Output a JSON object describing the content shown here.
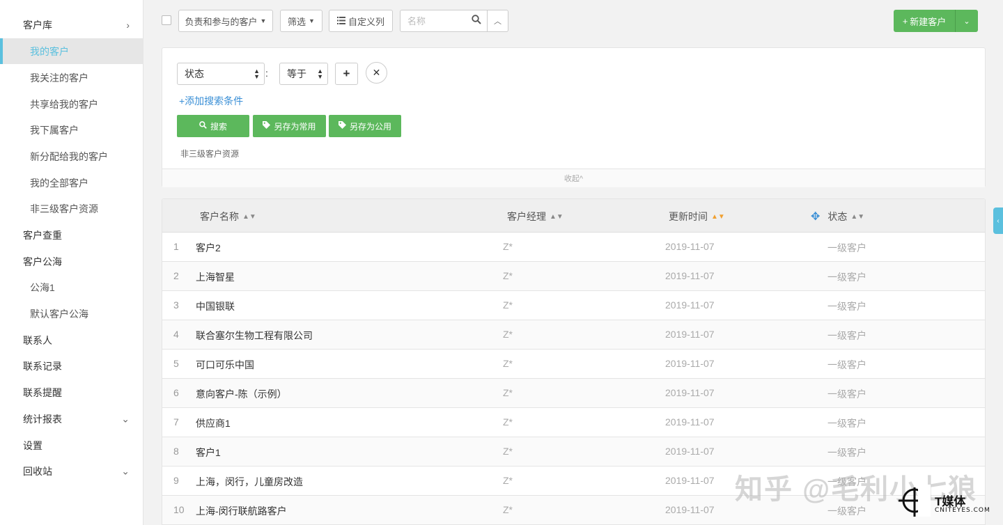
{
  "sidebar": {
    "items": [
      {
        "label": "客户库",
        "level": 1,
        "caret": "›"
      },
      {
        "label": "我的客户",
        "level": 2,
        "active": true
      },
      {
        "label": "我关注的客户",
        "level": 2
      },
      {
        "label": "共享给我的客户",
        "level": 2
      },
      {
        "label": "我下属客户",
        "level": 2
      },
      {
        "label": "新分配给我的客户",
        "level": 2
      },
      {
        "label": "我的全部客户",
        "level": 2
      },
      {
        "label": "非三级客户资源",
        "level": 2
      },
      {
        "label": "客户查重",
        "level": 1
      },
      {
        "label": "客户公海",
        "level": 1
      },
      {
        "label": "公海1",
        "level": 2
      },
      {
        "label": "默认客户公海",
        "level": 2
      },
      {
        "label": "联系人",
        "level": 1
      },
      {
        "label": "联系记录",
        "level": 1
      },
      {
        "label": "联系提醒",
        "level": 1
      },
      {
        "label": "统计报表",
        "level": 1,
        "caret": "⌄"
      },
      {
        "label": "设置",
        "level": 1
      },
      {
        "label": "回收站",
        "level": 1,
        "caret": "⌄"
      }
    ]
  },
  "toolbar": {
    "scope_label": "负责和参与的客户",
    "filter_label": "筛选",
    "custom_columns_label": "自定义列",
    "search_placeholder": "名称",
    "new_customer_label": "新建客户"
  },
  "filter": {
    "field_value": "状态",
    "colon": ":",
    "operator_value": "等于",
    "add_condition_label": "添加搜索条件",
    "search_button": "搜索",
    "save_common_button": "另存为常用",
    "save_public_button": "另存为公用",
    "note": "非三级客户资源",
    "collapse_label": "收起^"
  },
  "table": {
    "headers": [
      "客户名称",
      "客户经理",
      "更新时间",
      "状态"
    ],
    "rows": [
      {
        "idx": "1",
        "name": "客户2",
        "manager": "Z*",
        "date": "2019-11-07",
        "status": "一级客户"
      },
      {
        "idx": "2",
        "name": "上海智星",
        "manager": "Z*",
        "date": "2019-11-07",
        "status": "一级客户"
      },
      {
        "idx": "3",
        "name": "中国银联",
        "manager": "Z*",
        "date": "2019-11-07",
        "status": "一级客户"
      },
      {
        "idx": "4",
        "name": "联合塞尔生物工程有限公司",
        "manager": "Z*",
        "date": "2019-11-07",
        "status": "一级客户"
      },
      {
        "idx": "5",
        "name": "可口可乐中国",
        "manager": "Z*",
        "date": "2019-11-07",
        "status": "一级客户"
      },
      {
        "idx": "6",
        "name": "意向客户-陈（示例）",
        "manager": "Z*",
        "date": "2019-11-07",
        "status": "一级客户"
      },
      {
        "idx": "7",
        "name": "供应商1",
        "manager": "Z*",
        "date": "2019-11-07",
        "status": "一级客户"
      },
      {
        "idx": "8",
        "name": "客户1",
        "manager": "Z*",
        "date": "2019-11-07",
        "status": "一级客户"
      },
      {
        "idx": "9",
        "name": "上海，闵行，儿童房改造",
        "manager": "Z*",
        "date": "2019-11-07",
        "status": "一级客户"
      },
      {
        "idx": "10",
        "name": "上海-闵行联航路客户",
        "manager": "Z*",
        "date": "2019-11-07",
        "status": "一级客户"
      }
    ]
  },
  "watermark": {
    "text": "知乎 @毛利小七狼",
    "brand": "T媒体",
    "brand_sub": "CNITEYES.COM"
  },
  "colors": {
    "accent": "#5bc0de",
    "green": "#5cb85c",
    "link": "#3a8fd6"
  }
}
